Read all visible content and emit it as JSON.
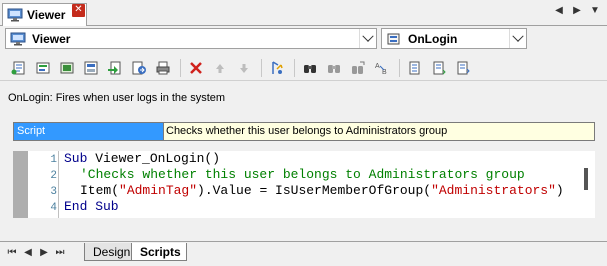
{
  "window": {
    "tab_title": "Viewer",
    "close_label": "✕",
    "nav_prev": "◀",
    "nav_next": "▶",
    "nav_down": "▼"
  },
  "selectors": {
    "object": "Viewer",
    "event": "OnLogin"
  },
  "toolbar": {
    "icons": [
      "new-script-icon",
      "insert-event-icon",
      "insert-form-icon",
      "insert-field-icon",
      "import-icon",
      "export-icon",
      "print-icon",
      "delete-icon",
      "move-up-icon",
      "move-down-icon",
      "check-syntax-icon",
      "find-icon",
      "find-next-icon",
      "replace-icon",
      "ab-replace-icon",
      "indent-icon",
      "outdent-icon",
      "comment-icon"
    ]
  },
  "description": "OnLogin: Fires when user logs in the system",
  "property": {
    "name": "Script",
    "value": "Checks whether this user belongs to Administrators group"
  },
  "code": {
    "line_numbers": [
      "1",
      "2",
      "3",
      "4"
    ],
    "line1_kw": "Sub",
    "line1_rest": " Viewer_OnLogin()",
    "line2_comment": "'Checks whether this user belongs to Administrators group",
    "line3_a": "Item(",
    "line3_str1": "\"AdminTag\"",
    "line3_b": ").Value = IsUserMemberOfGroup(",
    "line3_str2": "\"Administrators\"",
    "line3_c": ")",
    "line4_kw": "End Sub"
  },
  "bottom_nav": {
    "first": "⏮",
    "prev": "◀",
    "next": "▶",
    "last": "⏭"
  },
  "bottom_tabs": {
    "design": "Design",
    "scripts": "Scripts"
  },
  "colors": {
    "selection": "#3399ff",
    "tooltip_bg": "#ffffe1",
    "keyword": "#00008b",
    "comment": "#008000",
    "string": "#c00000",
    "close_button": "#c42b1c"
  }
}
